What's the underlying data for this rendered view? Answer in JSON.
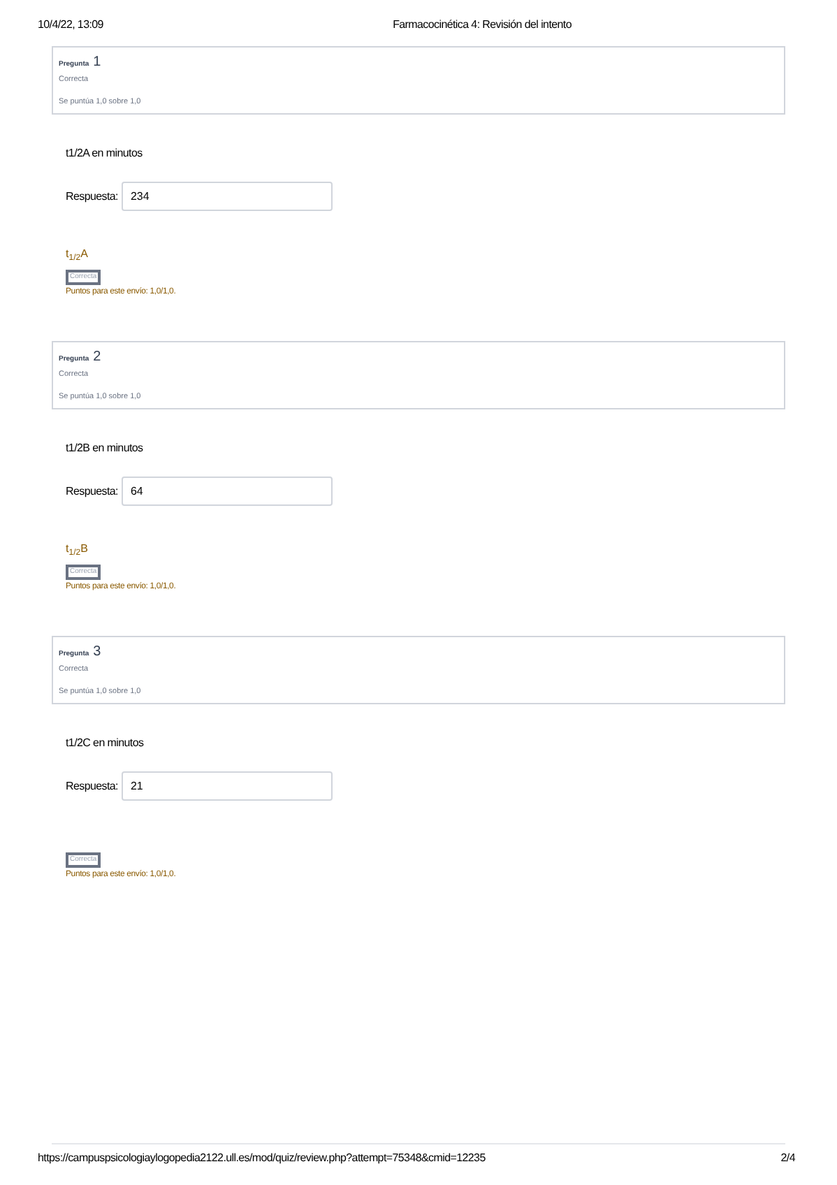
{
  "header": {
    "date": "10/4/22, 13:09",
    "title": "Farmacocinética 4: Revisión del intento"
  },
  "questions": [
    {
      "label": "Pregunta",
      "number": "1",
      "state": "Correcta",
      "grade": "Se puntúa 1,0 sobre 1,0",
      "text": "t1/2A en minutos",
      "answer_label": "Respuesta:",
      "answer": "234",
      "feedback": "t$_{1/2}$A",
      "badge": "Correcta",
      "points": "Puntos para este envío: 1,0/1,0."
    },
    {
      "label": "Pregunta",
      "number": "2",
      "state": "Correcta",
      "grade": "Se puntúa 1,0 sobre 1,0",
      "text": "t1/2B en minutos",
      "answer_label": "Respuesta:",
      "answer": "64",
      "feedback": "t$_{1/2}$B",
      "badge": "Correcta",
      "points": "Puntos para este envío: 1,0/1,0."
    },
    {
      "label": "Pregunta",
      "number": "3",
      "state": "Correcta",
      "grade": "Se puntúa 1,0 sobre 1,0",
      "text": "t1/2C en minutos",
      "answer_label": "Respuesta:",
      "answer": "21",
      "badge": "Correcta",
      "points": "Puntos para este envío: 1,0/1,0."
    }
  ],
  "footer": {
    "url": "https://campuspsicologiaylogopedia2122.ull.es/mod/quiz/review.php?attempt=75348&cmid=12235",
    "page": "2/4"
  }
}
